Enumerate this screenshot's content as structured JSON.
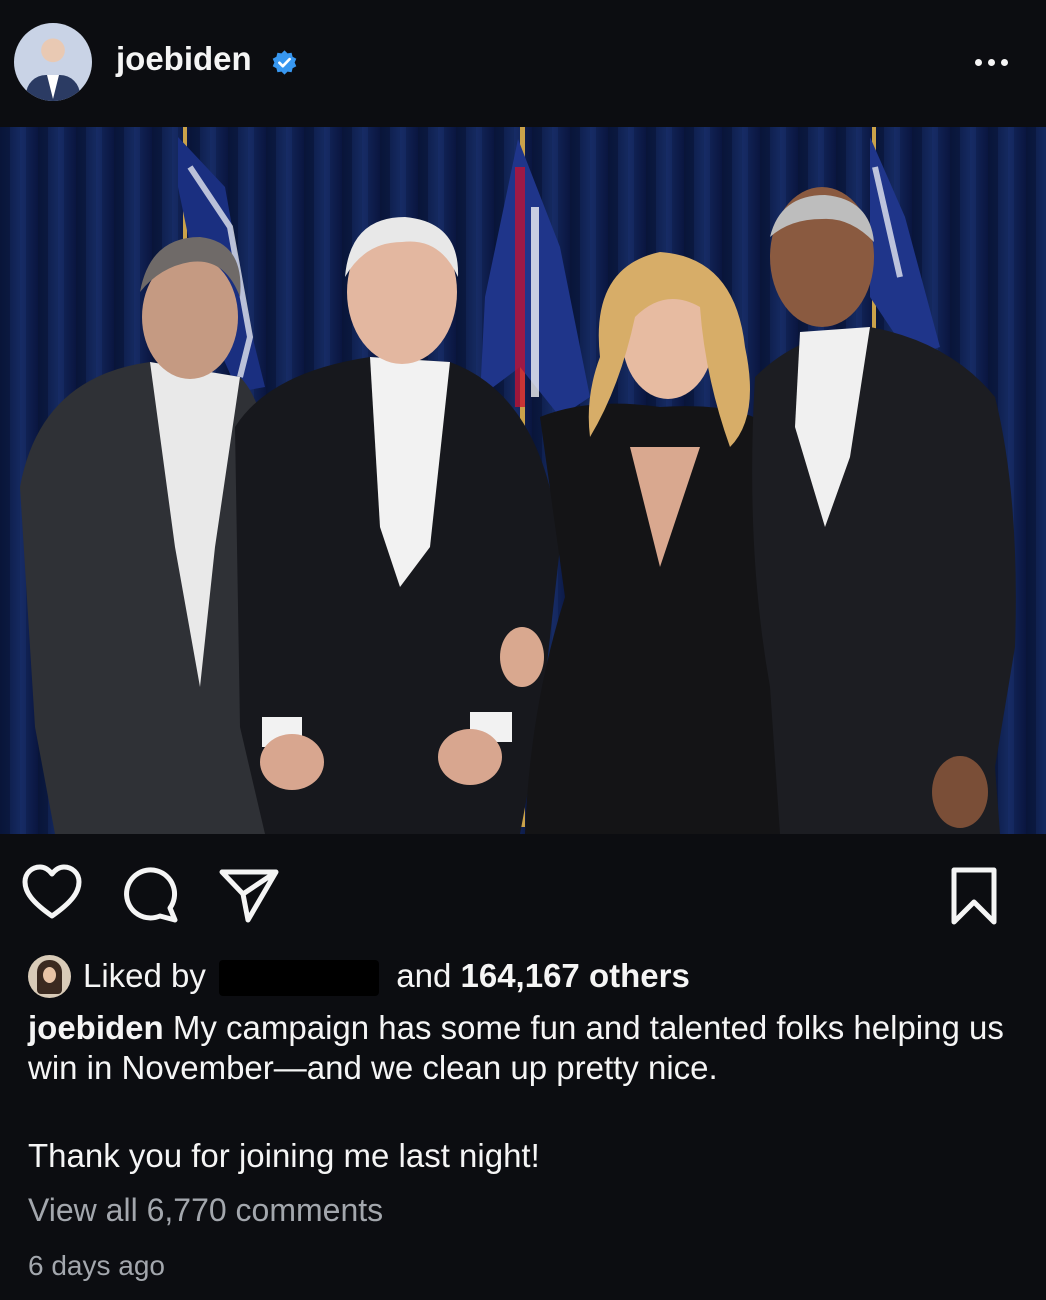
{
  "post": {
    "username": "joebiden",
    "verified_icon": "verified-badge-icon",
    "more_icon": "more-options-icon"
  },
  "actions": {
    "like_icon": "heart-icon",
    "comment_icon": "comment-icon",
    "share_icon": "send-icon",
    "save_icon": "bookmark-icon"
  },
  "likes": {
    "prefix": "Liked by",
    "and_text": "and",
    "count_text": "164,167 others"
  },
  "caption": {
    "username": "joebiden",
    "text": "My campaign has some fun and talented folks helping us win in November—and we clean up pretty nice.",
    "text2": "Thank you for joining me last night!"
  },
  "comments": {
    "view_all": "View all 6,770 comments"
  },
  "timestamp": "6 days ago",
  "colors": {
    "background": "#0c0d11",
    "verified_blue": "#3897f0",
    "muted_text": "#a3a7ad"
  }
}
